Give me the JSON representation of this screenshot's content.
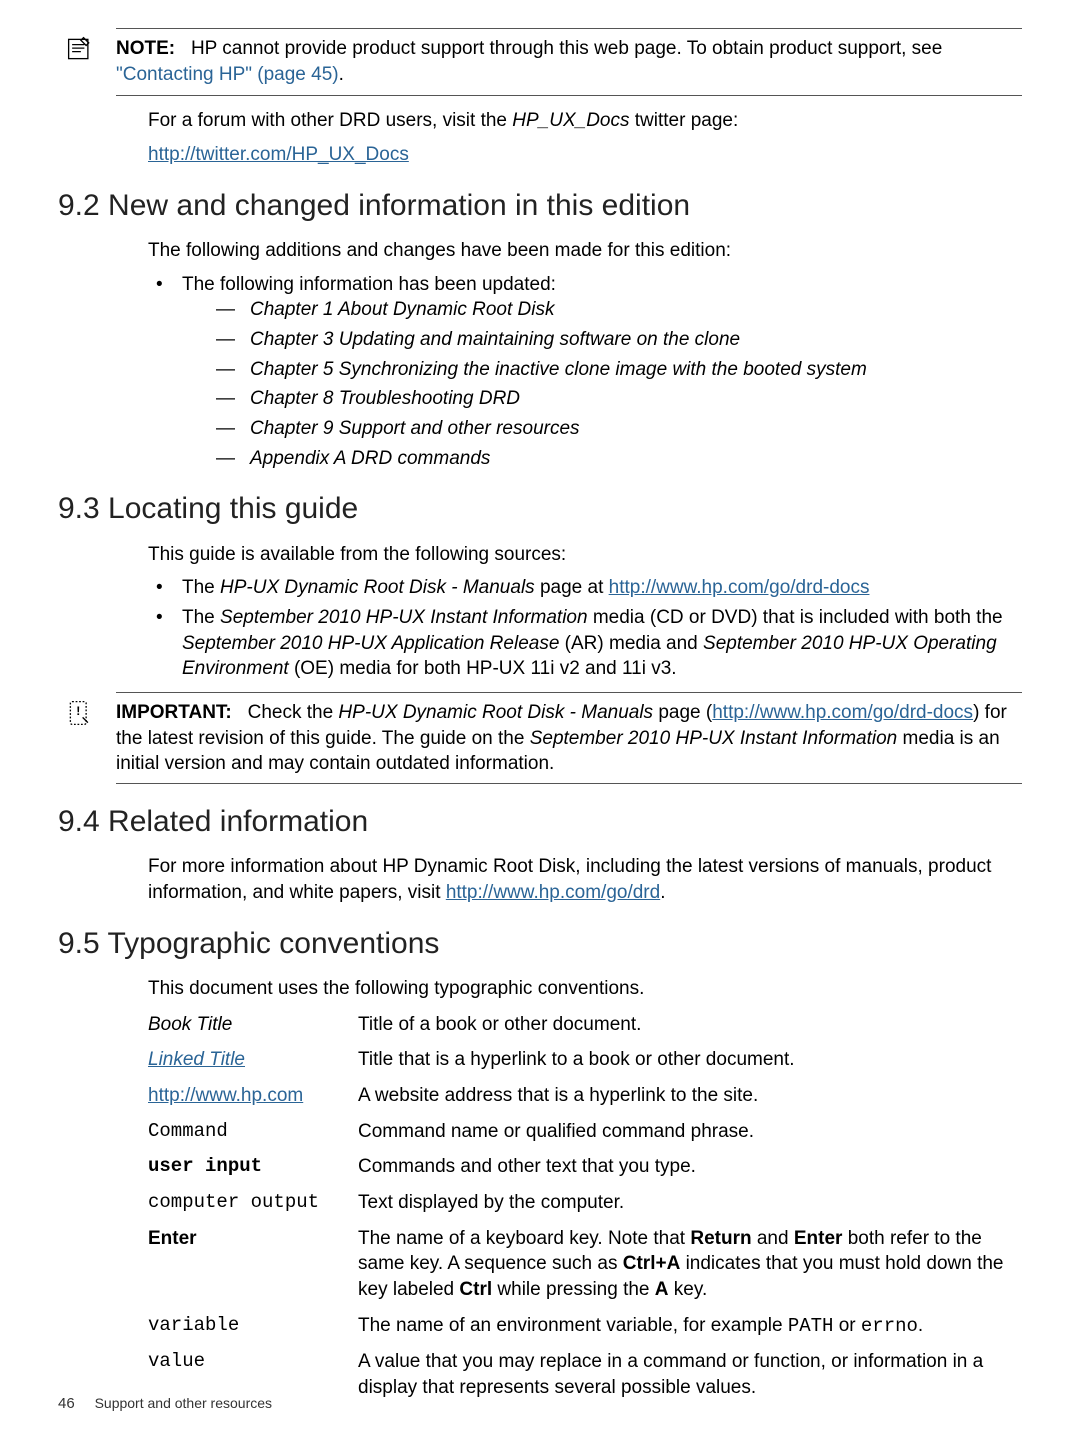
{
  "note": {
    "label": "NOTE:",
    "text_prefix": "HP cannot provide product support through this web page. To obtain product support, see ",
    "link_text": "\"Contacting HP\" (page 45)",
    "text_suffix": "."
  },
  "forum": {
    "line1_prefix": "For a forum with other DRD users, visit the ",
    "line1_italic": "HP_UX_Docs",
    "line1_suffix": " twitter page:",
    "link": "http://twitter.com/HP_UX_Docs"
  },
  "s92": {
    "heading": "9.2 New and changed information in this edition",
    "intro": "The following additions and changes have been made for this edition:",
    "bullet1": "The following information has been updated:",
    "dashes": [
      "Chapter 1 About Dynamic Root Disk",
      "Chapter 3 Updating and maintaining software on the clone",
      "Chapter 5 Synchronizing the inactive clone image with the booted system",
      "Chapter 8 Troubleshooting DRD",
      "Chapter 9 Support and other resources",
      "Appendix A DRD commands"
    ]
  },
  "s93": {
    "heading": "9.3 Locating this guide",
    "intro": "This guide is available from the following sources:",
    "b1_prefix": "The ",
    "b1_italic": "HP-UX Dynamic Root Disk - Manuals ",
    "b1_mid": " page at ",
    "b1_link": "http://www.hp.com/go/drd-docs",
    "b2_prefix": "The ",
    "b2_italic1": "September 2010 HP-UX Instant Information",
    "b2_mid1": " media (CD or DVD) that is included with both the ",
    "b2_italic2": "September 2010 HP-UX Application Release",
    "b2_mid2": " (AR) media and ",
    "b2_italic3": "September 2010 HP-UX Operating Environment",
    "b2_suffix": " (OE) media for both HP-UX 11i v2 and 11i v3."
  },
  "important": {
    "label": "IMPORTANT:",
    "prefix": "Check the ",
    "italic1": "HP-UX Dynamic Root Disk - Manuals",
    "mid1": " page (",
    "link1": "http://www.hp.com/go/drd-docs",
    "mid2": ") for the latest revision of this guide. The guide on the ",
    "italic2": "September 2010 HP-UX Instant Information",
    "suffix": " media is an initial version and may contain outdated information."
  },
  "s94": {
    "heading": "9.4 Related information",
    "text_prefix": "For more information about HP Dynamic Root Disk, including the latest versions of manuals, product information, and white papers, visit ",
    "link": "http://www.hp.com/go/drd",
    "text_suffix": "."
  },
  "s95": {
    "heading": "9.5 Typographic conventions",
    "intro": "This document uses the following typographic conventions.",
    "rows": {
      "book_title": {
        "term": "Book Title",
        "def": "Title of a book or other document."
      },
      "linked_title": {
        "term": "Linked Title",
        "def": "Title that is a hyperlink to a book or other document."
      },
      "url": {
        "term": "http://www.hp.com",
        "def": "A website address that is a hyperlink to the site."
      },
      "command": {
        "term": "Command",
        "def": "Command name or qualified command phrase."
      },
      "user_input": {
        "term": "user input",
        "def": "Commands and other text that you type."
      },
      "computer_output": {
        "term": "computer output",
        "def": "Text displayed by the computer."
      },
      "enter": {
        "term": "Enter",
        "d1": "The name of a keyboard key. Note that ",
        "b1": "Return",
        "d2": " and ",
        "b2": "Enter",
        "d3": " both refer to the same key. A sequence such as ",
        "b3": "Ctrl+A",
        "d4": " indicates that you must hold down the key labeled ",
        "b4": "Ctrl",
        "d5": " while pressing the ",
        "b5": "A",
        "d6": " key."
      },
      "variable": {
        "term": "variable",
        "d1": "The name of an environment variable, for example ",
        "m1": "PATH",
        "d2": " or ",
        "m2": "errno",
        "d3": "."
      },
      "value": {
        "term": "value",
        "def": "A value that you may replace in a command or function, or information in a display that represents several possible values."
      }
    }
  },
  "footer": {
    "page": "46",
    "title": "Support and other resources"
  }
}
